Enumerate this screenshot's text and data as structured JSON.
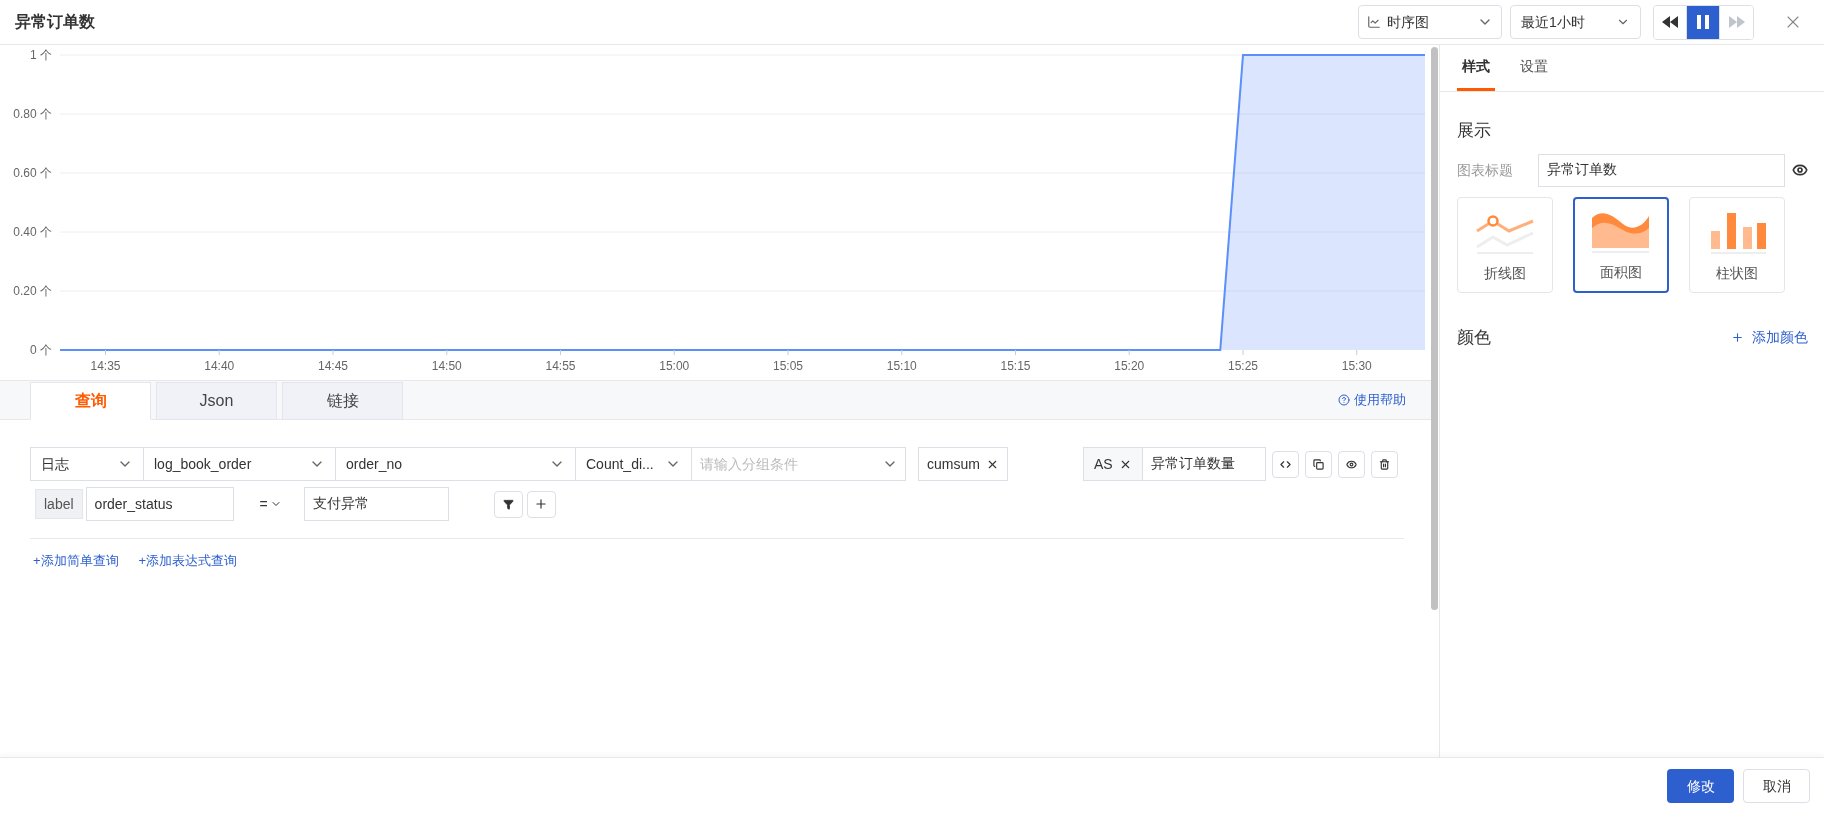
{
  "header": {
    "title": "异常订单数",
    "chart_type_select": {
      "value": "时序图"
    },
    "time_range_select": {
      "value": "最近1小时"
    },
    "playback_buttons": [
      {
        "kind": "rewind",
        "active": false,
        "disabled": false
      },
      {
        "kind": "pause",
        "active": true,
        "disabled": false
      },
      {
        "kind": "forward",
        "active": false,
        "disabled": true
      }
    ]
  },
  "chart": {
    "chart_data": {
      "type": "area",
      "grid": true,
      "x": [
        873,
        924,
        925,
        933
      ],
      "series": [
        {
          "color": "#5b8ff9",
          "values": [
            0,
            0,
            1,
            1
          ]
        }
      ],
      "xlim": [
        873,
        933
      ],
      "ylim": [
        0,
        1
      ],
      "xticks": [
        {
          "value": 875,
          "label": "14:35"
        },
        {
          "value": 880,
          "label": "14:40"
        },
        {
          "value": 885,
          "label": "14:45"
        },
        {
          "value": 890,
          "label": "14:50"
        },
        {
          "value": 895,
          "label": "14:55"
        },
        {
          "value": 900,
          "label": "15:00"
        },
        {
          "value": 905,
          "label": "15:05"
        },
        {
          "value": 910,
          "label": "15:10"
        },
        {
          "value": 915,
          "label": "15:15"
        },
        {
          "value": 920,
          "label": "15:20"
        },
        {
          "value": 925,
          "label": "15:25"
        },
        {
          "value": 930,
          "label": "15:30"
        }
      ],
      "yticks": [
        {
          "value": 0,
          "label": "0 个"
        },
        {
          "value": 0.2,
          "label": "0.20 个"
        },
        {
          "value": 0.4,
          "label": "0.40 个"
        },
        {
          "value": 0.6,
          "label": "0.60 个"
        },
        {
          "value": 0.8,
          "label": "0.80 个"
        },
        {
          "value": 1,
          "label": "1 个"
        }
      ]
    }
  },
  "query_tabs": [
    {
      "label": "查询",
      "selected": true
    },
    {
      "label": "Json",
      "selected": false
    },
    {
      "label": "链接",
      "selected": false
    }
  ],
  "help_link": "使用帮助",
  "query": {
    "source_select": "日志",
    "logstore_select": "log_book_order",
    "field_select": "order_no",
    "function_select": "Count_di...",
    "group_field": {
      "placeholder": "请输入分组条件"
    },
    "tags": [
      "cumsum"
    ],
    "alias_tag": "AS",
    "alias_field": "异常订单数量",
    "action_buttons": [
      {
        "kind": "code"
      },
      {
        "kind": "copy"
      },
      {
        "kind": "eye"
      },
      {
        "kind": "delete"
      }
    ],
    "filter": {
      "label_tag": "label",
      "key_field": "order_status",
      "operator": "=",
      "value_field": "支付异常"
    }
  },
  "add_links": [
    "+添加简单查询",
    "+添加表达式查询"
  ],
  "side_panel": {
    "tabs": [
      {
        "label": "样式",
        "selected": true
      },
      {
        "label": "设置",
        "selected": false
      }
    ],
    "display_heading": "展示",
    "title_label": "图表标题",
    "title_field": "异常订单数",
    "chart_types": [
      {
        "kind": "line",
        "label": "折线图",
        "selected": false
      },
      {
        "kind": "area",
        "label": "面积图",
        "selected": true
      },
      {
        "kind": "bar",
        "label": "柱状图",
        "selected": false
      }
    ],
    "color_heading": "颜色",
    "add_color_link": "添加颜色"
  },
  "footer": {
    "buttons": [
      {
        "label": "修改",
        "primary": true
      },
      {
        "label": "取消",
        "primary": false
      }
    ]
  }
}
